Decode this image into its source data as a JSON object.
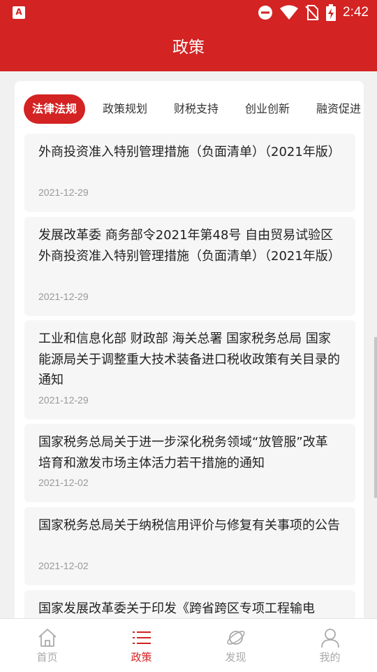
{
  "status": {
    "time": "2:42",
    "app_icon_letter": "A"
  },
  "header": {
    "title": "政策"
  },
  "tabs": [
    {
      "label": "法律法规",
      "active": true
    },
    {
      "label": "政策规划",
      "active": false
    },
    {
      "label": "财税支持",
      "active": false
    },
    {
      "label": "创业创新",
      "active": false
    },
    {
      "label": "融资促进",
      "active": false
    }
  ],
  "articles": [
    {
      "title": "外商投资准入特别管理措施（负面清单）（2021年版）",
      "date": "2021-12-29"
    },
    {
      "title": "发展改革委 商务部令2021年第48号 自由贸易试验区外商投资准入特别管理措施（负面清单）（2021年版）",
      "date": "2021-12-29"
    },
    {
      "title": "工业和信息化部 财政部 海关总署 国家税务总局 国家能源局关于调整重大技术装备进口税收政策有关目录的通知",
      "date": "2021-12-29"
    },
    {
      "title": "国家税务总局关于进一步深化税务领域“放管服”改革 培育和激发市场主体活力若干措施的通知",
      "date": "2021-12-02"
    },
    {
      "title": "国家税务总局关于纳税信用评价与修复有关事项的公告",
      "date": "2021-12-02"
    },
    {
      "title": "国家发展改革委关于印发《跨省跨区专项工程输电",
      "date": ""
    }
  ],
  "nav": [
    {
      "label": "首页",
      "icon": "home-icon",
      "active": false
    },
    {
      "label": "政策",
      "icon": "list-icon",
      "active": true
    },
    {
      "label": "发现",
      "icon": "planet-icon",
      "active": false
    },
    {
      "label": "我的",
      "icon": "user-icon",
      "active": false
    }
  ],
  "colors": {
    "brand": "#d32322",
    "inactive": "#aaaaaa"
  }
}
